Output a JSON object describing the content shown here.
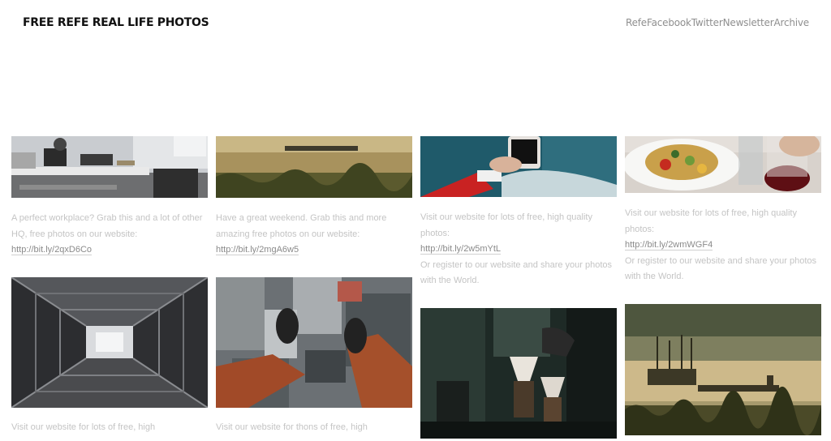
{
  "site": {
    "title": "FREE REFE REAL LIFE PHOTOS",
    "nav": [
      "Refe",
      "Facebook",
      "Twitter",
      "Newsletter",
      "Archive"
    ]
  },
  "posts": [
    {
      "image": "workplace desk with laptop",
      "text1": "A perfect workplace? Grab this and a lot of other HQ, free photos on our website:",
      "link": "http://bit.ly/2qxD6Co",
      "text2": ""
    },
    {
      "image": "misty lake with boat",
      "text1": "Have a great weekend. Grab this and more amazing free photos on our website:",
      "link": "http://bit.ly/2mgA6w5",
      "text2": ""
    },
    {
      "image": "hand holding smartphone",
      "text1": "Visit our website for lots of free, high quality photos:",
      "link": "http://bit.ly/2w5mYtL",
      "text2": "Or register to our website and share your photos with the World."
    },
    {
      "image": "food plate with wine",
      "text1": "Visit our website for lots of free, high quality photos:",
      "link": "http://bit.ly/2wmWGF4",
      "text2": "Or register to our website and share your photos with the World."
    },
    {
      "image": "symmetric corridor",
      "text1": "Visit our website for lots of free, high",
      "link": "",
      "text2": ""
    },
    {
      "image": "feet above city",
      "text1": "Visit our website for thons of free, high",
      "link": "",
      "text2": ""
    },
    {
      "image": "pour over coffee",
      "text1": "",
      "link": "",
      "text2": ""
    },
    {
      "image": "foggy lake with boat",
      "text1": "",
      "link": "",
      "text2": ""
    }
  ]
}
